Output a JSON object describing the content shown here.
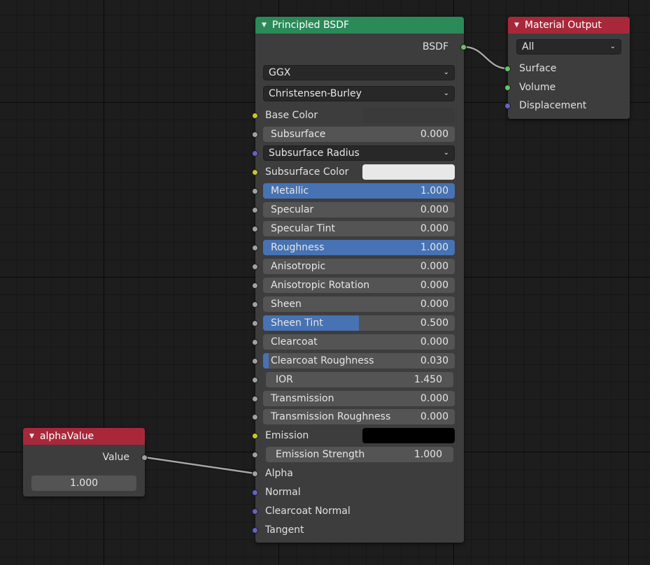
{
  "principled": {
    "title": "Principled BSDF",
    "output_label": "BSDF",
    "distribution": "GGX",
    "subsurface_method": "Christensen-Burley",
    "base_color_label": "Base Color",
    "subsurface": {
      "label": "Subsurface",
      "value": "0.000",
      "fraction": 0
    },
    "subsurface_radius": "Subsurface Radius",
    "subsurface_color_label": "Subsurface Color",
    "metallic": {
      "label": "Metallic",
      "value": "1.000",
      "fraction": 1
    },
    "specular": {
      "label": "Specular",
      "value": "0.000",
      "fraction": 0
    },
    "specular_tint": {
      "label": "Specular Tint",
      "value": "0.000",
      "fraction": 0
    },
    "roughness": {
      "label": "Roughness",
      "value": "1.000",
      "fraction": 1
    },
    "anisotropic": {
      "label": "Anisotropic",
      "value": "0.000",
      "fraction": 0
    },
    "anisotropic_rotation": {
      "label": "Anisotropic Rotation",
      "value": "0.000",
      "fraction": 0
    },
    "sheen": {
      "label": "Sheen",
      "value": "0.000",
      "fraction": 0
    },
    "sheen_tint": {
      "label": "Sheen Tint",
      "value": "0.500",
      "fraction": 0.5
    },
    "clearcoat": {
      "label": "Clearcoat",
      "value": "0.000",
      "fraction": 0
    },
    "clearcoat_roughness": {
      "label": "Clearcoat Roughness",
      "value": "0.030",
      "fraction": 0.03
    },
    "ior": {
      "label": "IOR",
      "value": "1.450"
    },
    "transmission": {
      "label": "Transmission",
      "value": "0.000",
      "fraction": 0
    },
    "transmission_roughness": {
      "label": "Transmission Roughness",
      "value": "0.000",
      "fraction": 0
    },
    "emission_label": "Emission",
    "emission_strength": {
      "label": "Emission Strength",
      "value": "1.000"
    },
    "alpha_label": "Alpha",
    "normal_label": "Normal",
    "clearcoat_normal_label": "Clearcoat Normal",
    "tangent_label": "Tangent"
  },
  "material_output": {
    "title": "Material Output",
    "target": "All",
    "surface_label": "Surface",
    "volume_label": "Volume",
    "displacement_label": "Displacement"
  },
  "alpha_value_node": {
    "title": "alphaValue",
    "output_label": "Value",
    "value": "1.000"
  },
  "colors": {
    "header_shader": "#2a8a58",
    "header_output": "#a8283a",
    "slider_fill": "#4772b3",
    "subsurface_color": "#e8e8e8",
    "emission_color": "#000000",
    "base_color": "#3a3a3a"
  }
}
